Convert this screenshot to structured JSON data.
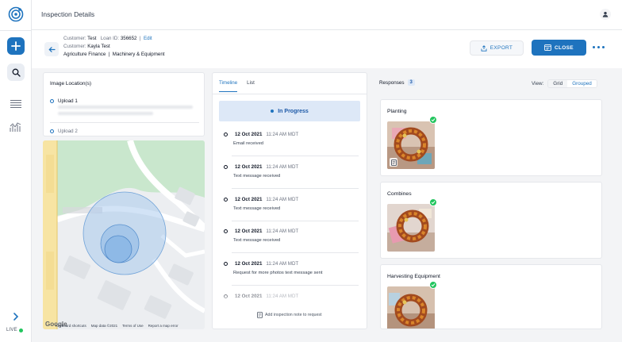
{
  "window": {
    "title": "Inspection Details"
  },
  "rail": {
    "live_label": "LIVE"
  },
  "header": {
    "customer_label": "Customer:",
    "customer_value": "Test",
    "loan_label": "Loan ID:",
    "loan_value": "356652",
    "edit_label": "Edit",
    "customer2_label": "Customer:",
    "customer2_value": "Kayla Test",
    "category": "Agriculture Finance",
    "subcategory": "Machinery & Equipment",
    "export_label": "EXPORT",
    "close_label": "CLOSE"
  },
  "location": {
    "title": "Image Location(s)",
    "uploads": [
      "Upload 1",
      "Upload 2"
    ]
  },
  "map": {
    "attribution": [
      "Keyboard shortcuts",
      "Map data ©2021",
      "Terms of Use",
      "Report a map error"
    ],
    "logo": "Google"
  },
  "timeline": {
    "tabs": [
      "Timeline",
      "List"
    ],
    "status": "In Progress",
    "events": [
      {
        "date": "12 Oct 2021",
        "time": "11:24 AM MDT",
        "text": "Email received"
      },
      {
        "date": "12 Oct 2021",
        "time": "11:24 AM MDT",
        "text": "Text message received"
      },
      {
        "date": "12 Oct 2021",
        "time": "11:24 AM MDT",
        "text": "Text message received"
      },
      {
        "date": "12 Oct 2021",
        "time": "11:24 AM MDT",
        "text": "Text message received"
      },
      {
        "date": "12 Oct 2021",
        "time": "11:24 AM MDT",
        "text": "Request for more photos text message sent"
      },
      {
        "date": "12 Oct 2021",
        "time": "11:24 AM MDT",
        "text": ""
      }
    ],
    "add_note": "Add inspection note to request"
  },
  "responses": {
    "label": "Responses",
    "count": "3",
    "view_label": "View:",
    "view_options": [
      "Grid",
      "Grouped"
    ],
    "groups": [
      {
        "title": "Planting"
      },
      {
        "title": "Combines"
      },
      {
        "title": "Harvesting Equipment"
      }
    ]
  },
  "colors": {
    "accent": "#1e73be",
    "success": "#22c55e",
    "status_bg": "#dde8f7"
  }
}
